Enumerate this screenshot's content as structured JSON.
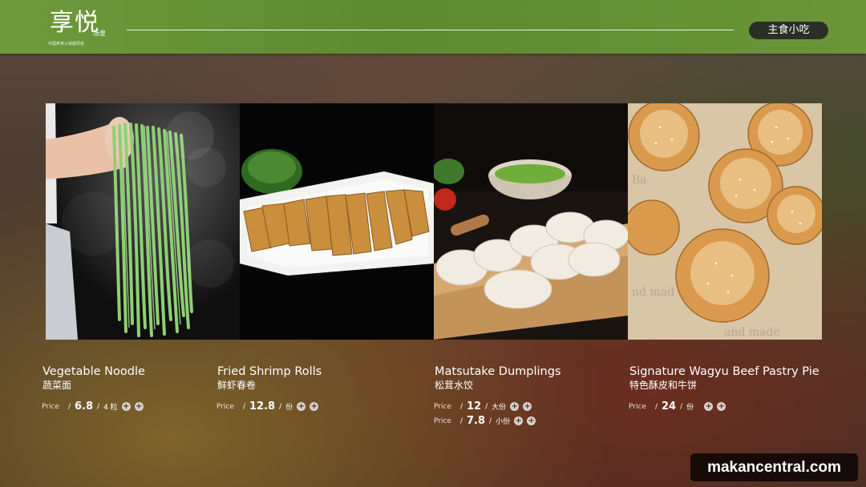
{
  "header": {
    "logo_main": "享悦",
    "logo_small": "汤皇",
    "logo_sub": "中国养身火锅倡导者",
    "category": "主食小吃"
  },
  "items": [
    {
      "name": "Vegetable Noodle",
      "name_cn": "蔬菜面",
      "prices": [
        {
          "label": "Price",
          "value": "6.8",
          "unit": "4 粒"
        }
      ]
    },
    {
      "name": "Fried Shrimp Rolls",
      "name_cn": "鲜虾春卷",
      "prices": [
        {
          "label": "Price",
          "value": "12.8",
          "unit": "份"
        }
      ]
    },
    {
      "name": "Matsutake Dumplings",
      "name_cn": "松茸水饺",
      "prices": [
        {
          "label": "Price",
          "value": "12",
          "unit": "大份"
        },
        {
          "label": "Price",
          "value": "7.8",
          "unit": "小份"
        }
      ]
    },
    {
      "name": "Signature Wagyu Beef Pastry Pie",
      "name_cn": "特色酥皮和牛饼",
      "prices": [
        {
          "label": "Price",
          "value": "24",
          "unit": "份"
        }
      ]
    }
  ],
  "watermark": "makancentral.com",
  "colors": {
    "header_green": "#6f9a3c",
    "pill_bg": "#2a2f26"
  }
}
